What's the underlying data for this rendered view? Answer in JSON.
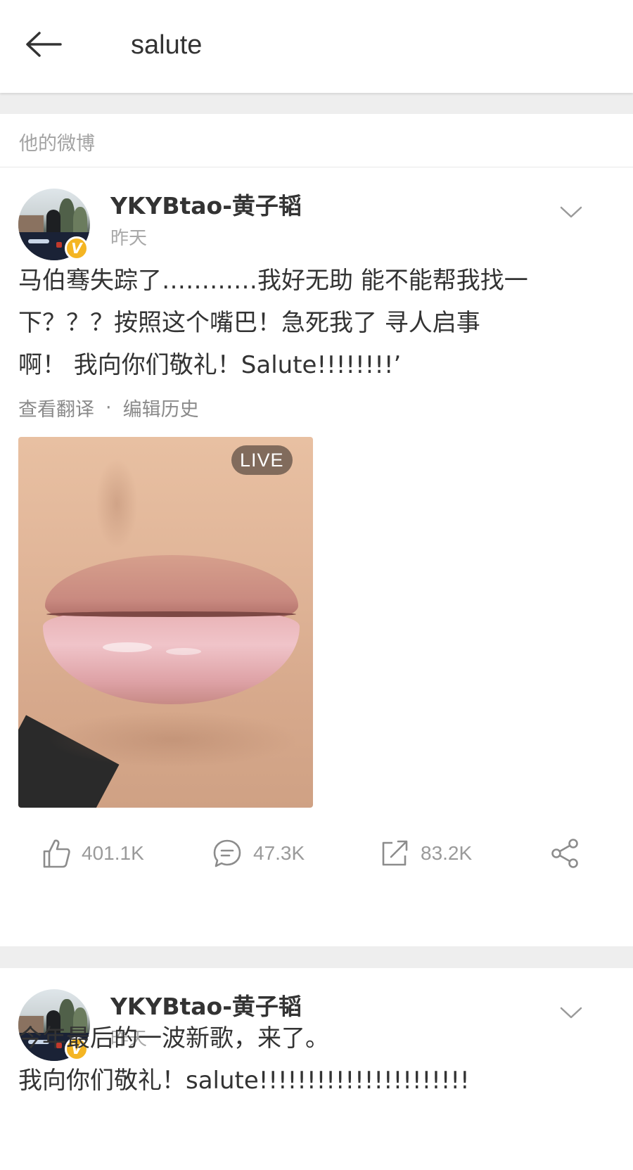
{
  "header": {
    "title": "salute"
  },
  "section_label": "他的微博",
  "posts": [
    {
      "username": "YKYBtao-黄子韬",
      "timestamp": "昨天",
      "verified_mark": "V",
      "text": "马伯骞失踪了…………我好无助 能不能帮我找一\n下？？？按照这个嘴巴！急死我了 寻人启事\n啊！ 我向你们敬礼！Salute!!!!!!!!’",
      "meta": {
        "translate": "查看翻译",
        "separator": "·",
        "edit_history": "编辑历史"
      },
      "media_badge": "LIVE",
      "actions": {
        "likes": "401.1K",
        "comments": "47.3K",
        "reposts": "83.2K"
      }
    },
    {
      "username": "YKYBtao-黄子韬",
      "timestamp": "昨天",
      "verified_mark": "V",
      "text": "今年最后的一波新歌，来了。\n我向你们敬礼！salute!!!!!!!!!!!!!!!!!!!!!!"
    }
  ],
  "colors": {
    "accent_badge": "#f4b523",
    "divider_gap": "#eeeeee",
    "muted_text": "#a3a3a3"
  },
  "icons": {
    "back": "arrow-left-icon",
    "more": "chevron-down-icon",
    "like": "thumbs-up-icon",
    "comment": "comment-bubble-icon",
    "repost": "repost-arrow-icon",
    "share": "share-nodes-icon"
  }
}
